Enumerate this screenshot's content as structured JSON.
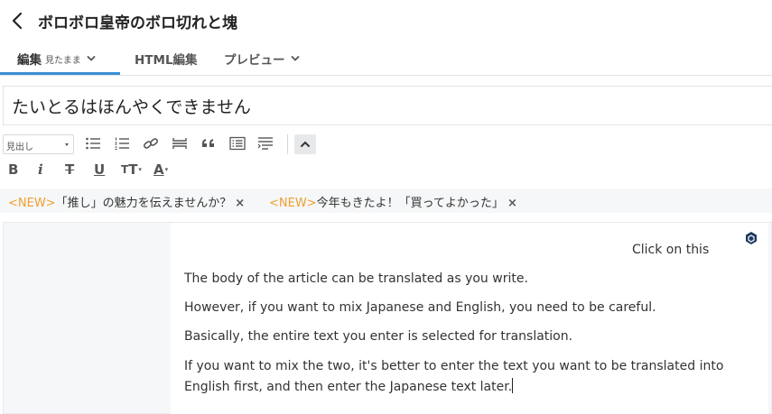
{
  "header": {
    "title": "ボロボロ皇帝のボロ切れと塊"
  },
  "tabs": {
    "edit_label": "編集",
    "edit_mode": "見たまま",
    "html_label": "HTML編集",
    "preview_label": "プレビュー"
  },
  "title_input": {
    "value": "たいとるはほんやくできません"
  },
  "toolbar": {
    "heading_select": "見出し",
    "bold": "B",
    "italic": "i",
    "strike": "T",
    "underline": "U",
    "text_size": "T",
    "text_color": "A"
  },
  "news": [
    {
      "tag": "<NEW>",
      "text": "「推し」の魅力を伝えませんか？",
      "close": "×"
    },
    {
      "tag": "<NEW>",
      "text": "今年もきたよ！「買ってよかった」",
      "close": "×"
    }
  ],
  "editor": {
    "hint": "Click on this",
    "paragraphs": [
      "The body of the article can be translated as you write.",
      "However, if you want to mix Japanese and English, you need to be careful.",
      "Basically, the entire text you enter is selected for translation.",
      "If you want to mix the two, it's better to enter the text you want to be translated into",
      "English first, and then enter the Japanese text later."
    ]
  },
  "colors": {
    "accent": "#3a8fd6",
    "new_tag": "#f0a030",
    "editor_bg": "#f6f7f8"
  },
  "icons": [
    "back-icon",
    "chevron-down-icon",
    "bullet-list-icon",
    "numbered-list-icon",
    "link-icon",
    "horizontal-rule-icon",
    "quote-icon",
    "table-of-contents-icon",
    "paragraph-align-icon",
    "chevron-up-icon",
    "hexagon-icon"
  ]
}
